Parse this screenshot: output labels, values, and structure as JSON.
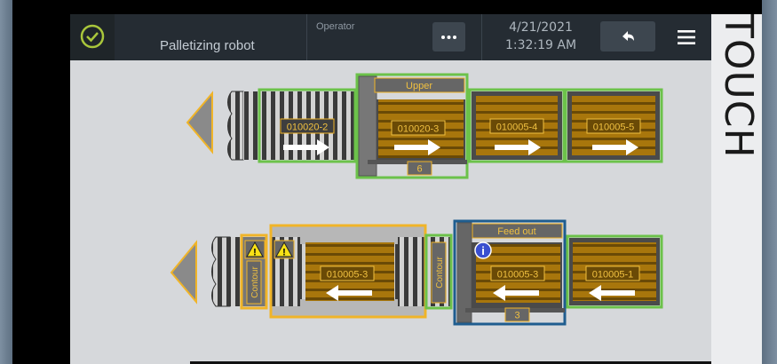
{
  "header": {
    "status_icon": "check-circle-icon",
    "title": "Palletizing robot",
    "operator_label": "Operator",
    "date": "4/21/2021",
    "time": "1:32:19 AM",
    "more_icon": "ellipsis-icon",
    "back_icon": "back-arrow-icon",
    "menu_icon": "hamburger-menu-icon"
  },
  "side_panel": {
    "text": "TOUCH"
  },
  "upper_line": {
    "station_label": "Upper",
    "station_count": "6",
    "direction": "left",
    "pallets": [
      "010020-2",
      "010020-3",
      "010005-4",
      "010005-5"
    ]
  },
  "lower_line": {
    "contour_label": "Contour",
    "contour_label_2": "Contour",
    "station_label": "Feed out",
    "station_count": "3",
    "direction": "left",
    "pallets": [
      "010005-3",
      "010005-3",
      "010005-1"
    ],
    "warning_icon": "warning-icon",
    "info_icon": "info-icon"
  },
  "colors": {
    "green": "#6cc24a",
    "orange": "#f0b428",
    "blue": "#1f5d8f",
    "header_bg": "#252c33",
    "content_bg": "#d6d8db",
    "pallet": "#a8760c",
    "label_text": "#f0c040"
  }
}
